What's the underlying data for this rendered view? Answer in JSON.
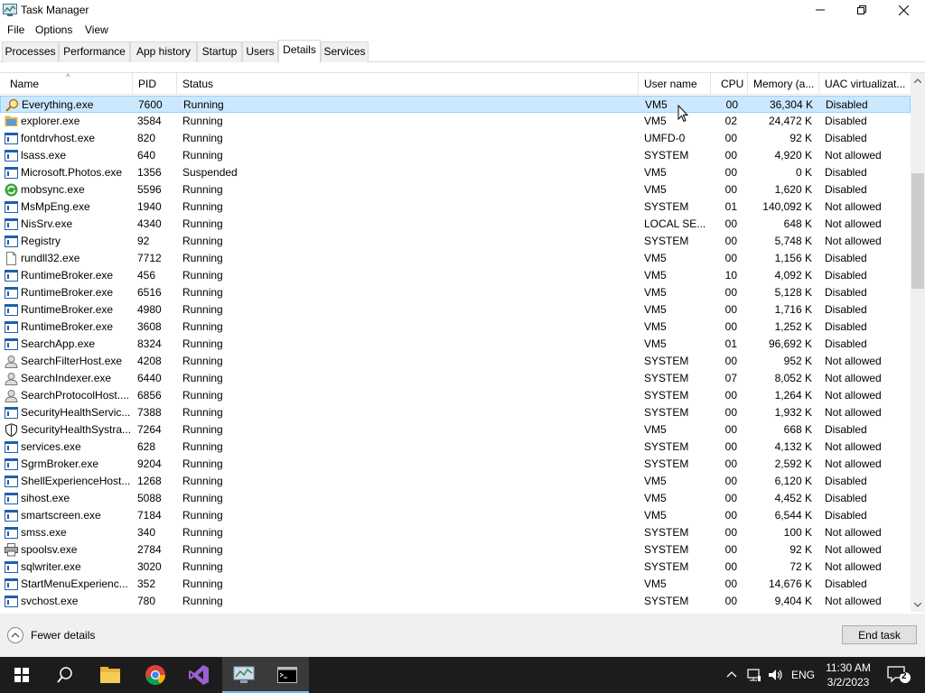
{
  "window": {
    "title": "Task Manager"
  },
  "menu": [
    "File",
    "Options",
    "View"
  ],
  "tabs": [
    "Processes",
    "Performance",
    "App history",
    "Startup",
    "Users",
    "Details",
    "Services"
  ],
  "active_tab": "Details",
  "columns": [
    "Name",
    "PID",
    "Status",
    "User name",
    "CPU",
    "Memory (a...",
    "UAC virtualizat..."
  ],
  "sorted_column": "Name",
  "selected_row": "Everything.exe",
  "rows": [
    {
      "name": "Everything.exe",
      "pid": "7600",
      "status": "Running",
      "user": "VM5",
      "cpu": "00",
      "mem": "36,304 K",
      "uac": "Disabled",
      "icon": "search-icon"
    },
    {
      "name": "explorer.exe",
      "pid": "3584",
      "status": "Running",
      "user": "VM5",
      "cpu": "02",
      "mem": "24,472 K",
      "uac": "Disabled",
      "icon": "folder-icon"
    },
    {
      "name": "fontdrvhost.exe",
      "pid": "820",
      "status": "Running",
      "user": "UMFD-0",
      "cpu": "00",
      "mem": "92 K",
      "uac": "Disabled",
      "icon": "process-icon"
    },
    {
      "name": "lsass.exe",
      "pid": "640",
      "status": "Running",
      "user": "SYSTEM",
      "cpu": "00",
      "mem": "4,920 K",
      "uac": "Not allowed",
      "icon": "process-icon"
    },
    {
      "name": "Microsoft.Photos.exe",
      "pid": "1356",
      "status": "Suspended",
      "user": "VM5",
      "cpu": "00",
      "mem": "0 K",
      "uac": "Disabled",
      "icon": "process-icon"
    },
    {
      "name": "mobsync.exe",
      "pid": "5596",
      "status": "Running",
      "user": "VM5",
      "cpu": "00",
      "mem": "1,620 K",
      "uac": "Disabled",
      "icon": "sync-icon"
    },
    {
      "name": "MsMpEng.exe",
      "pid": "1940",
      "status": "Running",
      "user": "SYSTEM",
      "cpu": "01",
      "mem": "140,092 K",
      "uac": "Not allowed",
      "icon": "process-icon"
    },
    {
      "name": "NisSrv.exe",
      "pid": "4340",
      "status": "Running",
      "user": "LOCAL SE...",
      "cpu": "00",
      "mem": "648 K",
      "uac": "Not allowed",
      "icon": "process-icon"
    },
    {
      "name": "Registry",
      "pid": "92",
      "status": "Running",
      "user": "SYSTEM",
      "cpu": "00",
      "mem": "5,748 K",
      "uac": "Not allowed",
      "icon": "process-icon"
    },
    {
      "name": "rundll32.exe",
      "pid": "7712",
      "status": "Running",
      "user": "VM5",
      "cpu": "00",
      "mem": "1,156 K",
      "uac": "Disabled",
      "icon": "file-icon"
    },
    {
      "name": "RuntimeBroker.exe",
      "pid": "456",
      "status": "Running",
      "user": "VM5",
      "cpu": "10",
      "mem": "4,092 K",
      "uac": "Disabled",
      "icon": "process-icon"
    },
    {
      "name": "RuntimeBroker.exe",
      "pid": "6516",
      "status": "Running",
      "user": "VM5",
      "cpu": "00",
      "mem": "5,128 K",
      "uac": "Disabled",
      "icon": "process-icon"
    },
    {
      "name": "RuntimeBroker.exe",
      "pid": "4980",
      "status": "Running",
      "user": "VM5",
      "cpu": "00",
      "mem": "1,716 K",
      "uac": "Disabled",
      "icon": "process-icon"
    },
    {
      "name": "RuntimeBroker.exe",
      "pid": "3608",
      "status": "Running",
      "user": "VM5",
      "cpu": "00",
      "mem": "1,252 K",
      "uac": "Disabled",
      "icon": "process-icon"
    },
    {
      "name": "SearchApp.exe",
      "pid": "8324",
      "status": "Running",
      "user": "VM5",
      "cpu": "01",
      "mem": "96,692 K",
      "uac": "Disabled",
      "icon": "process-icon"
    },
    {
      "name": "SearchFilterHost.exe",
      "pid": "4208",
      "status": "Running",
      "user": "SYSTEM",
      "cpu": "00",
      "mem": "952 K",
      "uac": "Not allowed",
      "icon": "user-search-icon"
    },
    {
      "name": "SearchIndexer.exe",
      "pid": "6440",
      "status": "Running",
      "user": "SYSTEM",
      "cpu": "07",
      "mem": "8,052 K",
      "uac": "Not allowed",
      "icon": "user-search-icon"
    },
    {
      "name": "SearchProtocolHost....",
      "pid": "6856",
      "status": "Running",
      "user": "SYSTEM",
      "cpu": "00",
      "mem": "1,264 K",
      "uac": "Not allowed",
      "icon": "user-search-icon"
    },
    {
      "name": "SecurityHealthServic...",
      "pid": "7388",
      "status": "Running",
      "user": "SYSTEM",
      "cpu": "00",
      "mem": "1,932 K",
      "uac": "Not allowed",
      "icon": "process-icon"
    },
    {
      "name": "SecurityHealthSystra...",
      "pid": "7264",
      "status": "Running",
      "user": "VM5",
      "cpu": "00",
      "mem": "668 K",
      "uac": "Disabled",
      "icon": "shield-icon"
    },
    {
      "name": "services.exe",
      "pid": "628",
      "status": "Running",
      "user": "SYSTEM",
      "cpu": "00",
      "mem": "4,132 K",
      "uac": "Not allowed",
      "icon": "process-icon"
    },
    {
      "name": "SgrmBroker.exe",
      "pid": "9204",
      "status": "Running",
      "user": "SYSTEM",
      "cpu": "00",
      "mem": "2,592 K",
      "uac": "Not allowed",
      "icon": "process-icon"
    },
    {
      "name": "ShellExperienceHost....",
      "pid": "1268",
      "status": "Running",
      "user": "VM5",
      "cpu": "00",
      "mem": "6,120 K",
      "uac": "Disabled",
      "icon": "process-icon"
    },
    {
      "name": "sihost.exe",
      "pid": "5088",
      "status": "Running",
      "user": "VM5",
      "cpu": "00",
      "mem": "4,452 K",
      "uac": "Disabled",
      "icon": "process-icon"
    },
    {
      "name": "smartscreen.exe",
      "pid": "7184",
      "status": "Running",
      "user": "VM5",
      "cpu": "00",
      "mem": "6,544 K",
      "uac": "Disabled",
      "icon": "process-icon"
    },
    {
      "name": "smss.exe",
      "pid": "340",
      "status": "Running",
      "user": "SYSTEM",
      "cpu": "00",
      "mem": "100 K",
      "uac": "Not allowed",
      "icon": "process-icon"
    },
    {
      "name": "spoolsv.exe",
      "pid": "2784",
      "status": "Running",
      "user": "SYSTEM",
      "cpu": "00",
      "mem": "92 K",
      "uac": "Not allowed",
      "icon": "printer-icon"
    },
    {
      "name": "sqlwriter.exe",
      "pid": "3020",
      "status": "Running",
      "user": "SYSTEM",
      "cpu": "00",
      "mem": "72 K",
      "uac": "Not allowed",
      "icon": "process-icon"
    },
    {
      "name": "StartMenuExperienc...",
      "pid": "352",
      "status": "Running",
      "user": "VM5",
      "cpu": "00",
      "mem": "14,676 K",
      "uac": "Disabled",
      "icon": "process-icon"
    },
    {
      "name": "svchost.exe",
      "pid": "780",
      "status": "Running",
      "user": "SYSTEM",
      "cpu": "00",
      "mem": "9,404 K",
      "uac": "Not allowed",
      "icon": "process-icon"
    }
  ],
  "footer": {
    "fewer_details": "Fewer details",
    "end_task": "End task"
  },
  "taskbar": {
    "apps": [
      "windows-start-icon",
      "search-icon",
      "file-explorer-icon",
      "chrome-icon",
      "visual-studio-icon",
      "task-manager-icon",
      "terminal-icon"
    ],
    "language": "ENG",
    "time": "11:30 AM",
    "date": "3/2/2023",
    "notification_count": "2"
  },
  "colors": {
    "selection": "#cce8ff",
    "selection_border": "#99d1ff",
    "taskbar": "#1c1c1c"
  }
}
